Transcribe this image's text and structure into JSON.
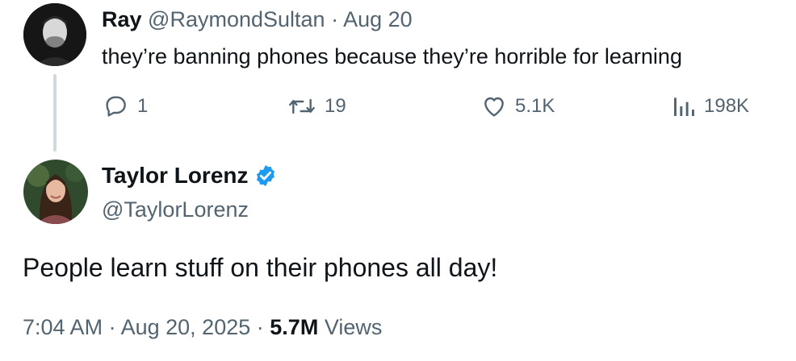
{
  "reply_tweet": {
    "author_name": "Ray",
    "handle": "@RaymondSultan",
    "separator": "·",
    "date": "Aug 20",
    "text": "they’re banning phones because they’re horrible for learning",
    "avatar_icon": "profile-photo-man",
    "actions": {
      "reply": {
        "icon": "reply-icon",
        "count": "1"
      },
      "retweet": {
        "icon": "retweet-icon",
        "count": "19"
      },
      "like": {
        "icon": "heart-icon",
        "count": "5.1K"
      },
      "views": {
        "icon": "analytics-icon",
        "count": "198K"
      }
    }
  },
  "main_tweet": {
    "author_name": "Taylor Lorenz",
    "handle": "@TaylorLorenz",
    "verified_icon": "verified-badge-icon",
    "avatar_icon": "profile-photo-woman",
    "text": "People learn stuff on their phones all day!",
    "time": "7:04 AM",
    "separator": "·",
    "date": "Aug 20, 2025",
    "views_count": "5.7M",
    "views_label": "Views"
  },
  "colors": {
    "text": "#0f1419",
    "muted": "#536471",
    "thread_line": "#cfd9de",
    "verified": "#1d9bf0"
  }
}
